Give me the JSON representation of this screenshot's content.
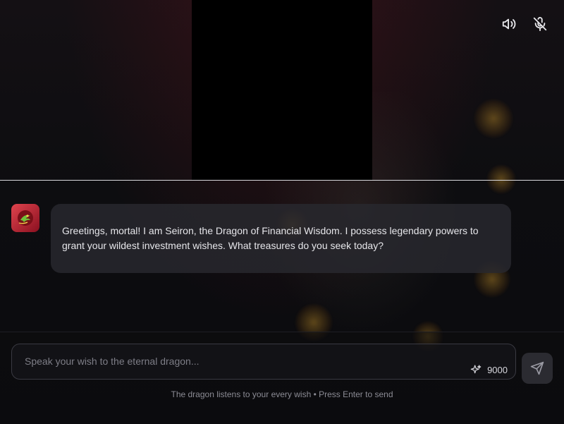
{
  "chat": {
    "messages": [
      {
        "sender": "dragon",
        "text": "Greetings, mortal! I am Seiron, the Dragon of Financial Wisdom. I possess legendary powers to grant your wildest investment wishes. What treasures do you seek today?"
      }
    ]
  },
  "composer": {
    "placeholder": "Speak your wish to the eternal dragon...",
    "value": "",
    "credits": "9000",
    "hint": "The dragon listens to your every wish • Press Enter to send"
  },
  "icons": {
    "volume": "volume-icon",
    "mic": "mic-off-icon",
    "avatar": "dragon-avatar",
    "sparkle": "sparkle-icon",
    "send": "send-icon"
  },
  "colors": {
    "accent": "#e0444e",
    "bubble": "#28282e",
    "background": "#0b0b0e"
  }
}
